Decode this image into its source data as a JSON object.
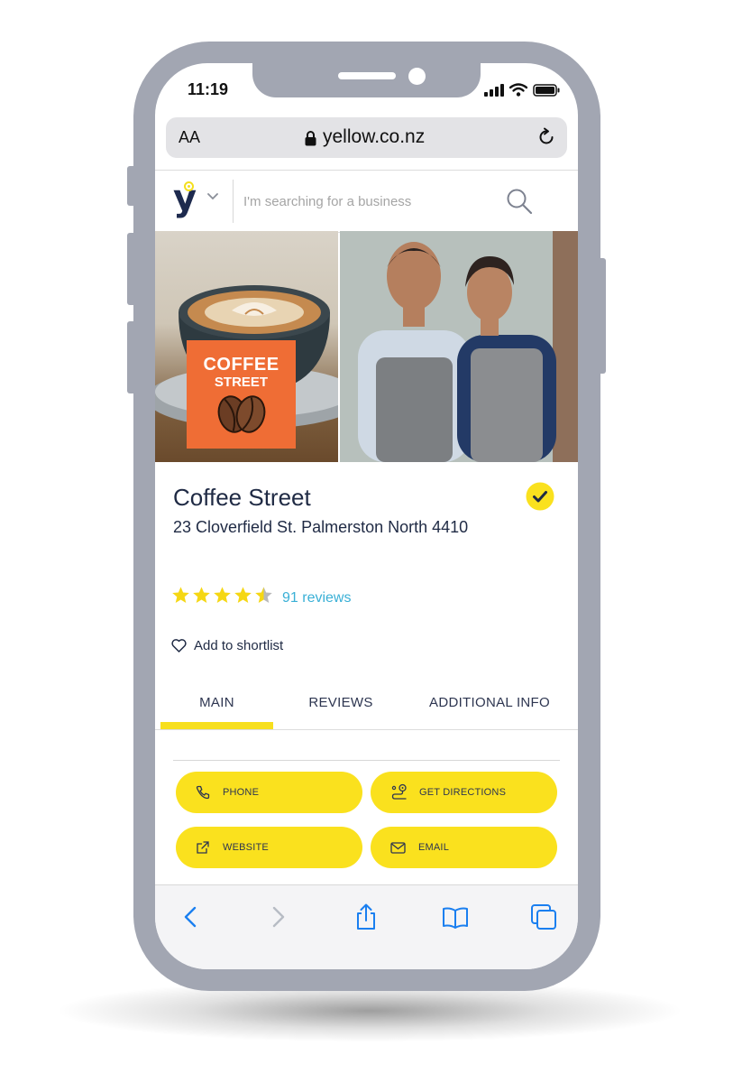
{
  "status_bar": {
    "time": "11:19"
  },
  "browser": {
    "text_size_label": "AA",
    "url": "yellow.co.nz"
  },
  "site_header": {
    "logo_text": "y",
    "search_placeholder": "I'm searching for a business"
  },
  "hero": {
    "logo_line1": "COFFEE",
    "logo_line2": "STREET"
  },
  "listing": {
    "name": "Coffee Street",
    "address": "23 Cloverfield St. Palmerston North 4410",
    "rating": 4.5,
    "rating_max": 5,
    "reviews_label": "91 reviews",
    "shortlist_label": "Add to shortlist"
  },
  "tabs": [
    {
      "label": "MAIN",
      "active": true
    },
    {
      "label": "REVIEWS",
      "active": false
    },
    {
      "label": "ADDITIONAL INFO",
      "active": false
    }
  ],
  "actions": {
    "phone": "PHONE",
    "directions": "GET DIRECTIONS",
    "website": "WEBSITE",
    "email": "EMAIL"
  },
  "colors": {
    "brand_yellow": "#fae11e",
    "brand_navy": "#1f2a44",
    "link_blue": "#3ab0d6",
    "star_yellow": "#f5d714",
    "device_frame": "#a2a6b2",
    "ios_blue": "#1a7ff0"
  },
  "icons": {
    "status": [
      "signal-icon",
      "wifi-icon",
      "battery-icon"
    ],
    "browser": [
      "lock-icon",
      "reload-icon"
    ],
    "header": [
      "chevron-down-icon",
      "search-icon"
    ],
    "listing": [
      "verified-check-icon",
      "star-icon",
      "heart-icon"
    ],
    "actions": [
      "phone-icon",
      "directions-icon",
      "external-link-icon",
      "mail-icon"
    ],
    "toolbar": [
      "back-icon",
      "forward-icon",
      "share-icon",
      "bookmarks-icon",
      "tabs-icon"
    ]
  }
}
